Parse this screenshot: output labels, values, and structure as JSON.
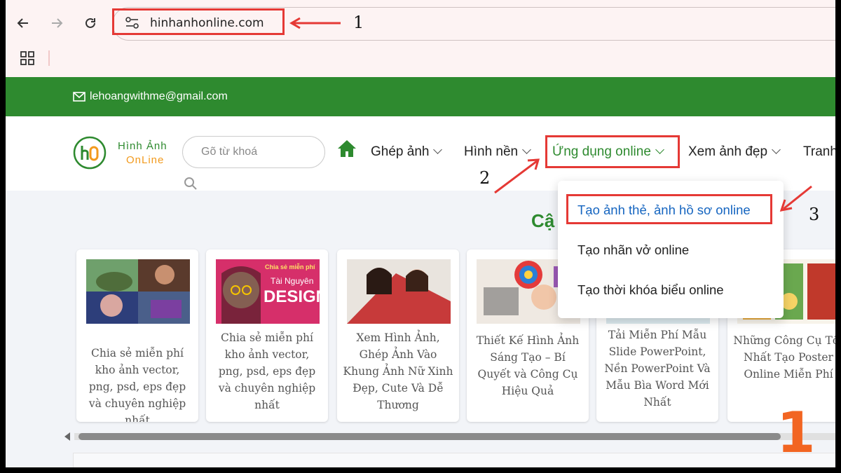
{
  "browser": {
    "url": "hinhanhonline.com"
  },
  "topbar": {
    "email": "lehoangwithme@gmail.com"
  },
  "header": {
    "brand_line1": "Hình Ảnh",
    "brand_line2": "OnLine",
    "search_placeholder": "Gõ từ khoá",
    "menu": [
      {
        "label": "Ghép ảnh"
      },
      {
        "label": "Hình nền"
      },
      {
        "label": "Ứng dụng online"
      },
      {
        "label": "Xem ảnh đẹp"
      },
      {
        "label": "Tranh"
      }
    ]
  },
  "dropdown": {
    "items": [
      {
        "label": "Tạo ảnh thẻ, ảnh hồ sơ online"
      },
      {
        "label": "Tạo nhãn vở online"
      },
      {
        "label": "Tạo thời khóa biểu online"
      }
    ]
  },
  "content": {
    "heading": "Cậ",
    "cards": [
      {
        "title": "Chia sẻ miễn phí kho ảnh vector, png, psd, eps đẹp và chuyên nghiệp nhất"
      },
      {
        "title": "Chia sẻ miễn phí kho ảnh vector, png, psd, eps đẹp và chuyên nghiệp nhất",
        "thumb_text_1": "Chia sẻ miễn phí",
        "thumb_text_2": "Tài Nguyên",
        "thumb_text_3": "DESIGN"
      },
      {
        "title": "Xem Hình Ảnh, Ghép Ảnh Vào Khung Ảnh Nữ Xinh Đẹp, Cute Và Dễ Thương"
      },
      {
        "title": "Thiết Kế Hình Ảnh Sáng Tạo – Bí Quyết và Công Cụ Hiệu Quả"
      },
      {
        "title": "Tải Miễn Phí Mẫu Slide PowerPoint, Nền PowerPoint Và Mẫu Bìa Word Mới Nhất"
      },
      {
        "title": "Những Công Cụ Tốt Nhất Tạo Poster Online Miễn Phí"
      }
    ]
  },
  "annotations": {
    "step1": "1",
    "step2": "2",
    "step3": "3",
    "big_number": "1"
  },
  "colors": {
    "brand_green": "#2e8a2f",
    "accent_orange": "#f26522",
    "annotation_red": "#e53935",
    "link_blue": "#1565c0"
  }
}
